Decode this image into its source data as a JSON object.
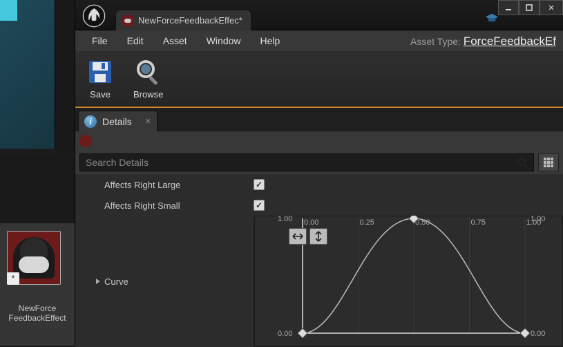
{
  "sidebar": {
    "asset_name_line1": "NewForce",
    "asset_name_line2": "FeedbackEffect"
  },
  "tab": {
    "title": "NewForceFeedbackEffec*"
  },
  "menubar": {
    "items": [
      "File",
      "Edit",
      "Asset",
      "Window",
      "Help"
    ],
    "asset_type_label": "Asset Type:",
    "asset_type_value": "ForceFeedbackEf"
  },
  "toolbar": {
    "save_label": "Save",
    "browse_label": "Browse"
  },
  "details": {
    "tab_label": "Details",
    "search_placeholder": "Search Details",
    "rows": {
      "affects_right_large": {
        "label": "Affects Right Large",
        "checked": true
      },
      "affects_right_small": {
        "label": "Affects Right Small",
        "checked": true
      },
      "curve_label": "Curve"
    }
  },
  "chart_data": {
    "type": "line",
    "title": "",
    "xlabel": "",
    "ylabel": "",
    "x_ticks": [
      0.0,
      0.25,
      0.5,
      0.75,
      1.0
    ],
    "y_ticks_left": [
      0.0,
      1.0
    ],
    "y_ticks_right": [
      0.0,
      1.0
    ],
    "xlim": [
      0.0,
      1.0
    ],
    "ylim": [
      0.0,
      1.0
    ],
    "keys": [
      {
        "x": 0.0,
        "y": 0.0
      },
      {
        "x": 0.5,
        "y": 1.0
      },
      {
        "x": 1.0,
        "y": 0.0
      }
    ],
    "interp": "cubic"
  }
}
